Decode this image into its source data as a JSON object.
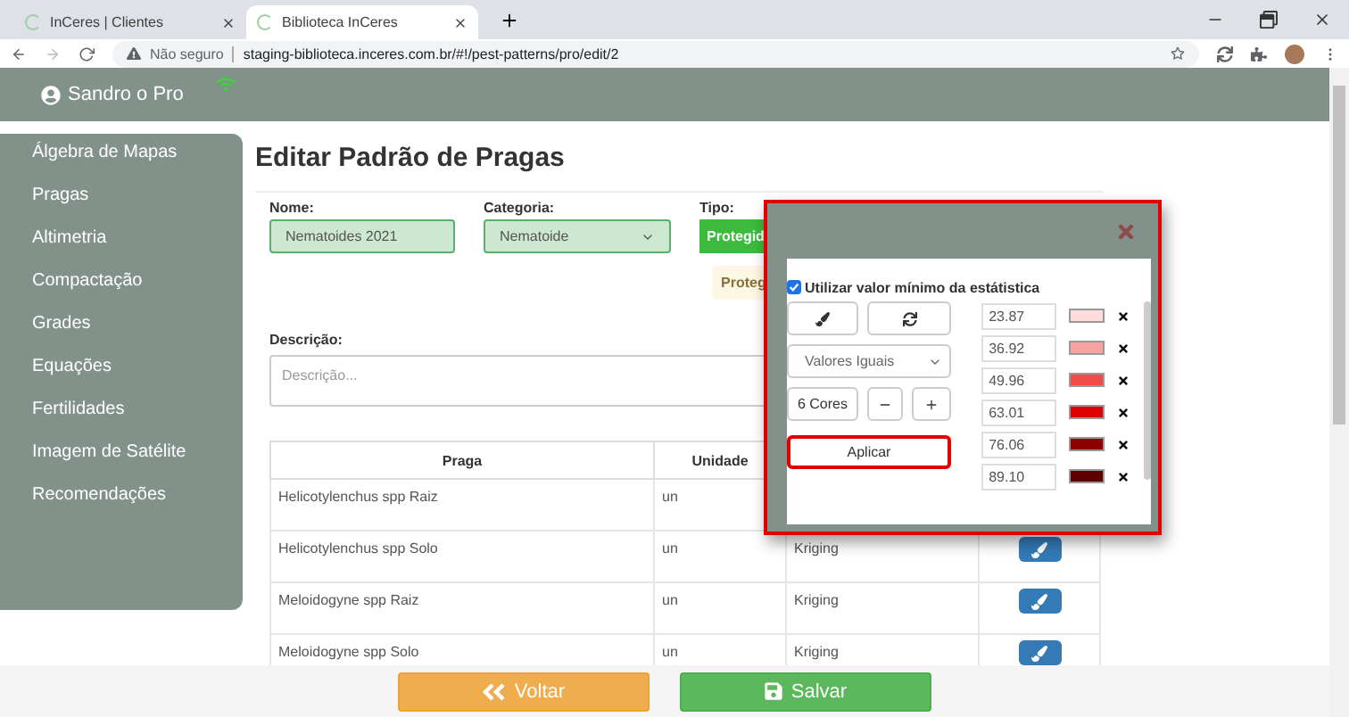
{
  "browser": {
    "tabs": [
      {
        "title": "InCeres | Clientes",
        "selected": false
      },
      {
        "title": "Biblioteca InCeres",
        "selected": true
      }
    ],
    "address": {
      "security": "Não seguro",
      "url": "staging-biblioteca.inceres.com.br/#!/pest-patterns/pro/edit/2"
    }
  },
  "header": {
    "user": "Sandro o Pro"
  },
  "sidebar": {
    "items": [
      {
        "label": "Álgebra de Mapas"
      },
      {
        "label": "Pragas"
      },
      {
        "label": "Altimetria"
      },
      {
        "label": "Compactação"
      },
      {
        "label": "Grades"
      },
      {
        "label": "Equações"
      },
      {
        "label": "Fertilidades"
      },
      {
        "label": "Imagem de Satélite"
      },
      {
        "label": "Recomendações"
      }
    ]
  },
  "page": {
    "title": "Editar Padrão de Pragas",
    "form": {
      "name_label": "Nome:",
      "name_value": "Nematoides 2021",
      "category_label": "Categoria:",
      "category_value": "Nematoide",
      "type_label": "Tipo:",
      "type_button": "Protegid",
      "type_badge": "Proteg",
      "description_label": "Descrição:",
      "description_placeholder": "Descrição..."
    }
  },
  "table": {
    "columns": [
      "Praga",
      "Unidade"
    ],
    "rows": [
      {
        "praga": "Helicotylenchus spp Raiz",
        "unidade": "un",
        "kind": "plain"
      },
      {
        "praga": "Helicotylenchus spp Solo",
        "unidade": "un",
        "column_3": "Kriging",
        "kind": "editable"
      },
      {
        "praga": "Meloidogyne spp Raiz",
        "unidade": "un",
        "column_3": "Kriging",
        "kind": "editable"
      },
      {
        "praga": "Meloidogyne spp Solo",
        "unidade": "un",
        "column_3": "Kriging",
        "kind": "editable"
      }
    ]
  },
  "modal": {
    "checkbox": {
      "label": "Utilizar valor mínimo da estátistica",
      "checked": true
    },
    "select_value": "Valores Iguais",
    "colors_count": "6 Cores",
    "apply_label": "Aplicar",
    "entries": [
      {
        "value": "23.87",
        "color": "#fcdcdc"
      },
      {
        "value": "36.92",
        "color": "#f7a1a1"
      },
      {
        "value": "49.96",
        "color": "#f04a4a"
      },
      {
        "value": "63.01",
        "color": "#dd0000"
      },
      {
        "value": "76.06",
        "color": "#8e0000"
      },
      {
        "value": "89.10",
        "color": "#5e0000"
      }
    ]
  },
  "footer": {
    "back_label": "Voltar",
    "save_label": "Salvar"
  }
}
